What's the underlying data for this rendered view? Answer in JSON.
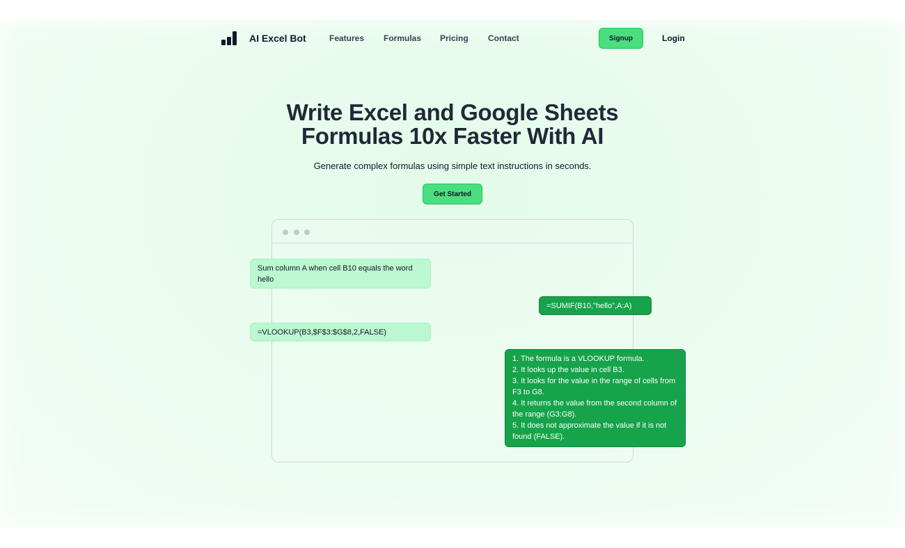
{
  "brand": {
    "name": "AI Excel Bot",
    "logo_icon": "bar-chart-icon"
  },
  "nav": {
    "links": [
      "Features",
      "Formulas",
      "Pricing",
      "Contact"
    ],
    "signup_label": "Signup",
    "login_label": "Login"
  },
  "hero": {
    "headline_line1": "Write Excel and Google Sheets",
    "headline_line2": "Formulas 10x Faster With AI",
    "subheadline": "Generate complex formulas using simple text instructions in seconds.",
    "cta_label": "Get Started"
  },
  "chat": {
    "messages": [
      {
        "role": "user",
        "text": "Sum column A when cell B10 equals the word hello"
      },
      {
        "role": "ai",
        "text": "=SUMIF(B10,\"hello\",A:A)"
      },
      {
        "role": "user",
        "text": "=VLOOKUP(B3,$F$3:$G$8,2,FALSE)"
      }
    ],
    "explanation": [
      "1. The formula is a VLOOKUP formula.",
      "2. It looks up the value in cell B3.",
      "3. It looks for the value in the range of cells from F3 to G8.",
      "4. It returns the value from the second column of the range (G3:G8).",
      "5. It does not approximate the value if it is not found (FALSE)."
    ]
  },
  "colors": {
    "accent": "#4ade80",
    "ai_bubble": "#16a34a",
    "user_bubble": "#bbf7d0",
    "heading": "#1f2937"
  }
}
